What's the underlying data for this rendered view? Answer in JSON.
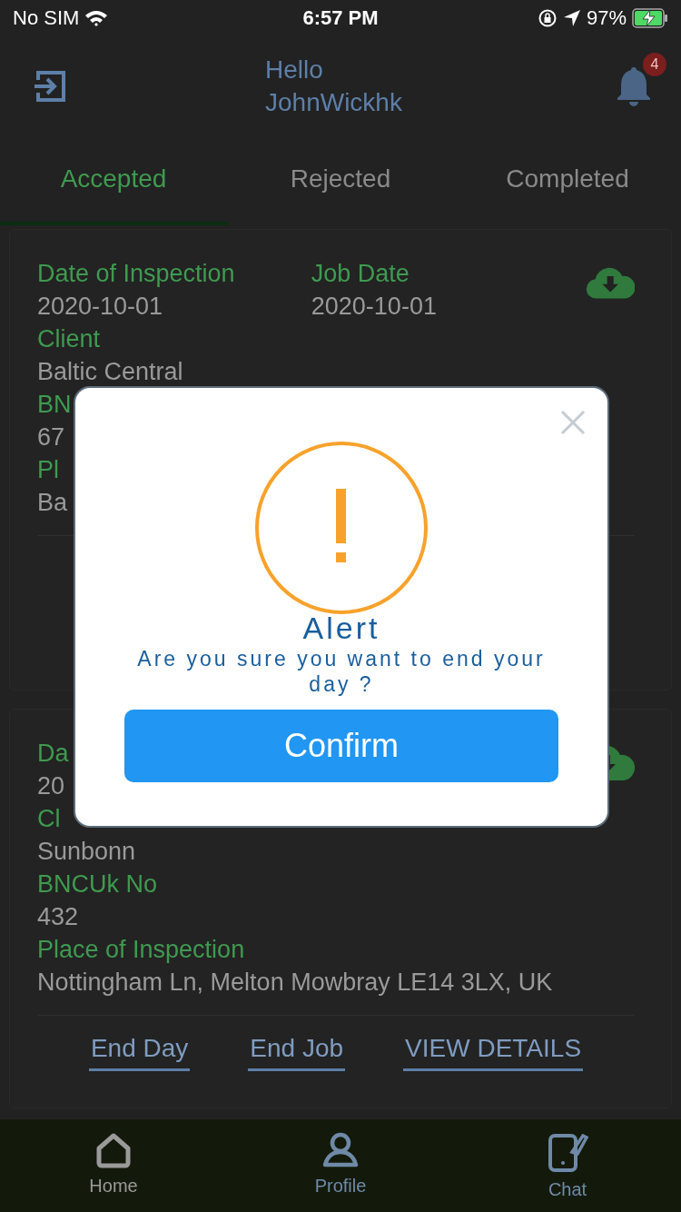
{
  "status_bar": {
    "carrier": "No SIM",
    "time": "6:57 PM",
    "battery": "97%"
  },
  "header": {
    "greeting": "Hello",
    "user": "JohnWickhk",
    "badge": "4"
  },
  "tabs": [
    {
      "label": "Accepted",
      "selected": true
    },
    {
      "label": "Rejected",
      "selected": false
    },
    {
      "label": "Completed",
      "selected": false
    }
  ],
  "cards": [
    {
      "top_fields": [
        {
          "label": "Date of Inspection",
          "value": "2020-10-01"
        },
        {
          "label": "Job Date",
          "value": "2020-10-01"
        }
      ],
      "fields": [
        {
          "label": "Client",
          "value": "Baltic Central"
        },
        {
          "label": "BN",
          "value": "67"
        },
        {
          "label": "Pl",
          "value": "Ba"
        }
      ]
    },
    {
      "top_fields": [
        {
          "label": "Da",
          "value": "20"
        }
      ],
      "fields": [
        {
          "label": "Cl",
          "value": "Sunbonn"
        },
        {
          "label": "BNCUk No",
          "value": "432"
        },
        {
          "label": "Place of Inspection",
          "value": "Nottingham Ln, Melton Mowbray LE14 3LX, UK"
        }
      ],
      "actions": [
        "End Day",
        "End Job",
        "VIEW DETAILS"
      ]
    }
  ],
  "bottom_nav": [
    {
      "label": "Home",
      "kind": "home",
      "selected": true
    },
    {
      "label": "Profile",
      "kind": "profile",
      "selected": false
    },
    {
      "label": "Chat",
      "kind": "chat",
      "selected": false
    }
  ],
  "modal": {
    "title": "Alert",
    "message": "Are you sure you want to end your day ?",
    "button": "Confirm"
  }
}
